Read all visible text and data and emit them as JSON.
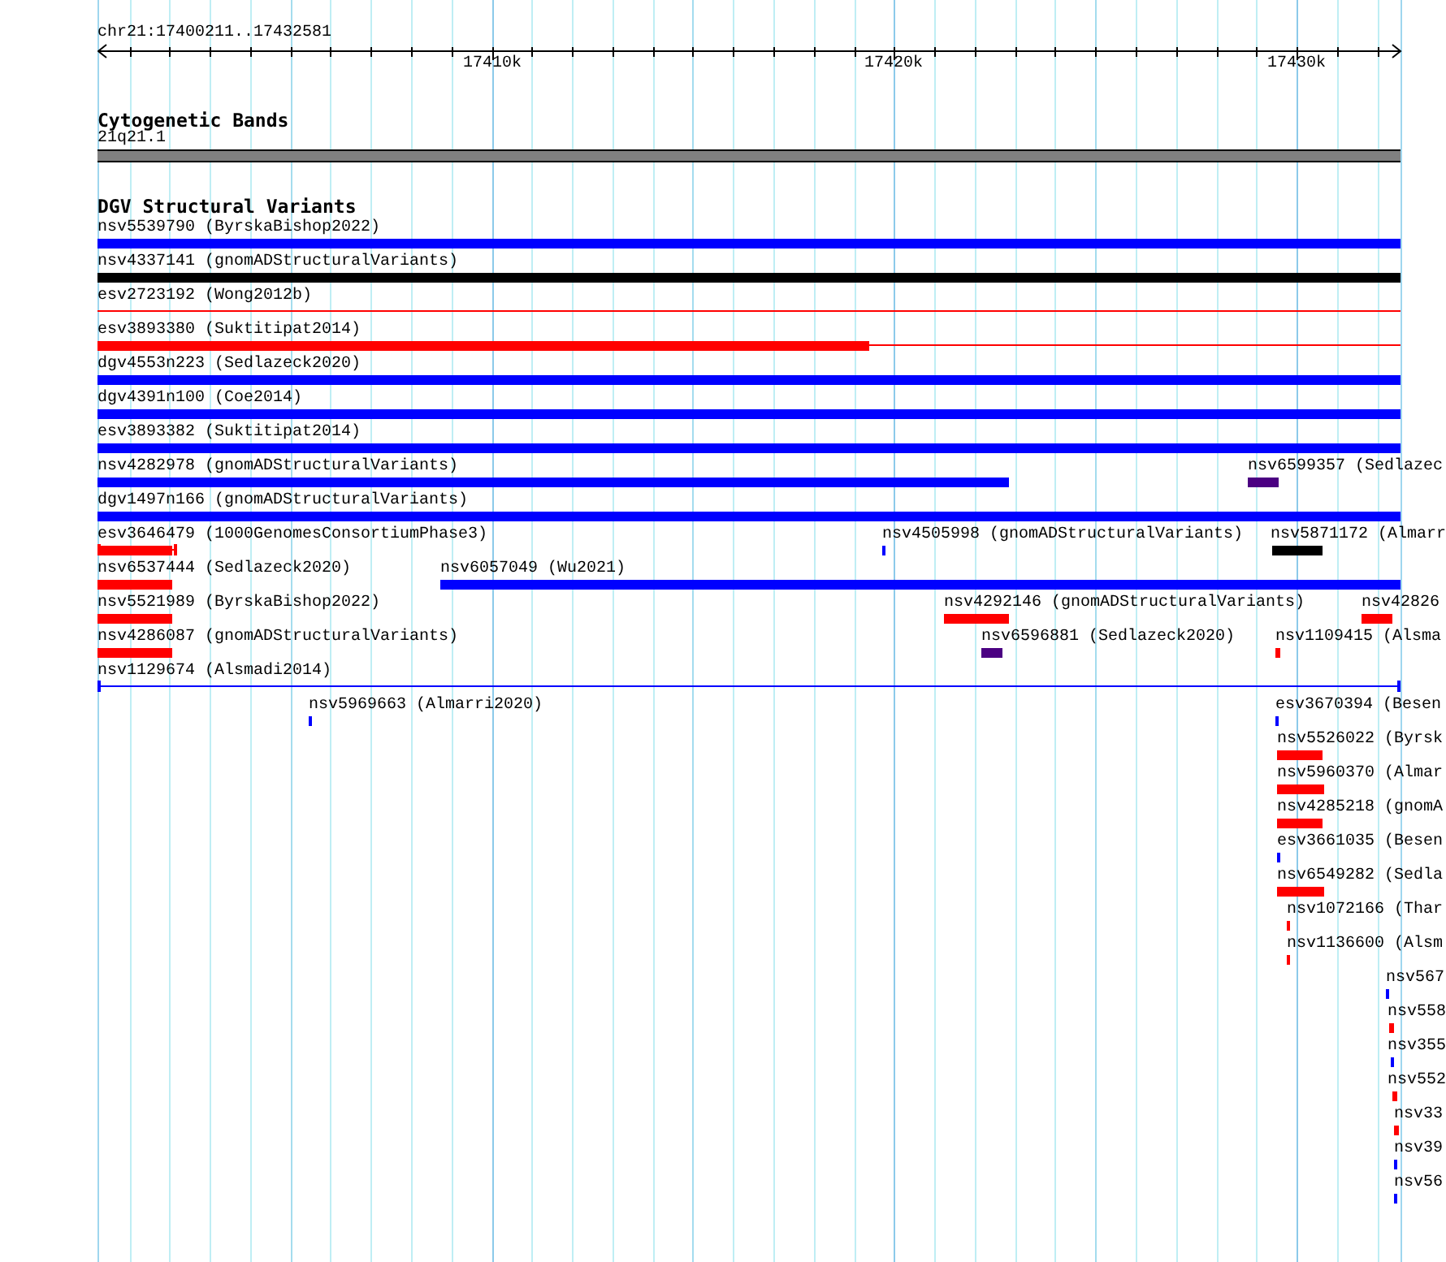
{
  "location": "chr21:17400211..17432581",
  "ruler": {
    "ticks": [
      "17410k",
      "17420k",
      "17430k"
    ]
  },
  "cytogenetic_bands": {
    "title": "Cytogenetic Bands",
    "band": "21q21.1"
  },
  "dgv_structural_variants": {
    "title": "DGV Structural Variants",
    "rows": [
      [
        {
          "label": "nsv5539790 (ByrskaBishop2022)",
          "kind": "bar",
          "color": "#0000ff",
          "capped": false
        }
      ],
      [
        {
          "label": "nsv4337141 (gnomADStructuralVariants)",
          "kind": "bar",
          "color": "#000000",
          "capped": false
        }
      ],
      [
        {
          "label": "esv2723192 (Wong2012b)",
          "kind": "line",
          "color": "#ff0000",
          "capped": false
        }
      ],
      [
        {
          "label": "esv3893380 (Suktitipat2014)",
          "kind": "bar_line",
          "color": "#ff0000",
          "capped": false
        }
      ],
      [
        {
          "label": "dgv4553n223 (Sedlazeck2020)",
          "kind": "bar",
          "color": "#0000ff",
          "capped": false
        }
      ],
      [
        {
          "label": "dgv4391n100 (Coe2014)",
          "kind": "bar",
          "color": "#0000ff",
          "capped": false
        }
      ],
      [
        {
          "label": "esv3893382 (Suktitipat2014)",
          "kind": "bar",
          "color": "#0000ff",
          "capped": false
        }
      ],
      [
        {
          "label": "nsv4282978 (gnomADStructuralVariants)",
          "kind": "bar",
          "color": "#0000ff",
          "capped": false
        },
        {
          "label": "nsv6599357 (Sedlazec",
          "kind": "bar",
          "color": "#4b0082",
          "capped": false
        }
      ],
      [
        {
          "label": "dgv1497n166 (gnomADStructuralVariants)",
          "kind": "bar",
          "color": "#0000ff",
          "capped": false
        }
      ],
      [
        {
          "label": "esv3646479 (1000GenomesConsortiumPhase3)",
          "kind": "bar_line",
          "color": "#ff0000",
          "capped": true
        },
        {
          "label": "nsv4505998 (gnomADStructuralVariants)",
          "kind": "bar",
          "color": "#0000ff",
          "capped": false
        },
        {
          "label": "nsv5871172 (Almarr",
          "kind": "bar",
          "color": "#000000",
          "capped": false
        }
      ],
      [
        {
          "label": "nsv6537444 (Sedlazeck2020)",
          "kind": "bar",
          "color": "#ff0000",
          "capped": false
        },
        {
          "label": "nsv6057049 (Wu2021)",
          "kind": "bar",
          "color": "#0000ff",
          "capped": false
        }
      ],
      [
        {
          "label": "nsv5521989 (ByrskaBishop2022)",
          "kind": "bar",
          "color": "#ff0000",
          "capped": false
        },
        {
          "label": "nsv4292146 (gnomADStructuralVariants)",
          "kind": "bar",
          "color": "#ff0000",
          "capped": false
        },
        {
          "label": "nsv42826",
          "kind": "bar",
          "color": "#ff0000",
          "capped": false
        }
      ],
      [
        {
          "label": "nsv4286087 (gnomADStructuralVariants)",
          "kind": "bar",
          "color": "#ff0000",
          "capped": false
        },
        {
          "label": "nsv6596881 (Sedlazeck2020)",
          "kind": "bar",
          "color": "#4b0082",
          "capped": false
        },
        {
          "label": "nsv1109415 (Alsma",
          "kind": "bar",
          "color": "#ff0000",
          "capped": false
        }
      ],
      [
        {
          "label": "nsv1129674 (Alsmadi2014)",
          "kind": "line",
          "color": "#0000ff",
          "capped": true
        }
      ],
      [
        {
          "label": "nsv5969663 (Almarri2020)",
          "kind": "bar",
          "color": "#0000ff",
          "capped": false
        },
        {
          "label": "esv3670394 (Besen",
          "kind": "bar",
          "color": "#0000ff",
          "capped": false
        }
      ],
      [
        {
          "label": "nsv5526022 (Byrsk",
          "kind": "bar",
          "color": "#ff0000",
          "capped": false
        }
      ],
      [
        {
          "label": "nsv5960370 (Almar",
          "kind": "bar",
          "color": "#ff0000",
          "capped": false
        }
      ],
      [
        {
          "label": "nsv4285218 (gnomA",
          "kind": "bar",
          "color": "#ff0000",
          "capped": false
        }
      ],
      [
        {
          "label": "esv3661035 (Besen",
          "kind": "bar",
          "color": "#0000ff",
          "capped": false
        }
      ],
      [
        {
          "label": "nsv6549282 (Sedla",
          "kind": "bar",
          "color": "#ff0000",
          "capped": false
        }
      ],
      [
        {
          "label": "nsv1072166 (Thar",
          "kind": "bar",
          "color": "#ff0000",
          "capped": false
        }
      ],
      [
        {
          "label": "nsv1136600 (Alsm",
          "kind": "bar",
          "color": "#ff0000",
          "capped": false
        }
      ],
      [
        {
          "label": "nsv567",
          "kind": "bar",
          "color": "#0000ff",
          "capped": false
        }
      ],
      [
        {
          "label": "nsv558",
          "kind": "bar",
          "color": "#ff0000",
          "capped": false
        }
      ],
      [
        {
          "label": "nsv355",
          "kind": "bar",
          "color": "#0000ff",
          "capped": false
        }
      ],
      [
        {
          "label": "nsv552",
          "kind": "bar",
          "color": "#ff0000",
          "capped": false
        }
      ],
      [
        {
          "label": "nsv33",
          "kind": "bar",
          "color": "#ff0000",
          "capped": false
        }
      ],
      [
        {
          "label": "nsv39",
          "kind": "bar",
          "color": "#0000ff",
          "capped": false
        }
      ],
      [
        {
          "label": "nsv56",
          "kind": "bar",
          "color": "#0000ff",
          "capped": false
        }
      ]
    ]
  }
}
